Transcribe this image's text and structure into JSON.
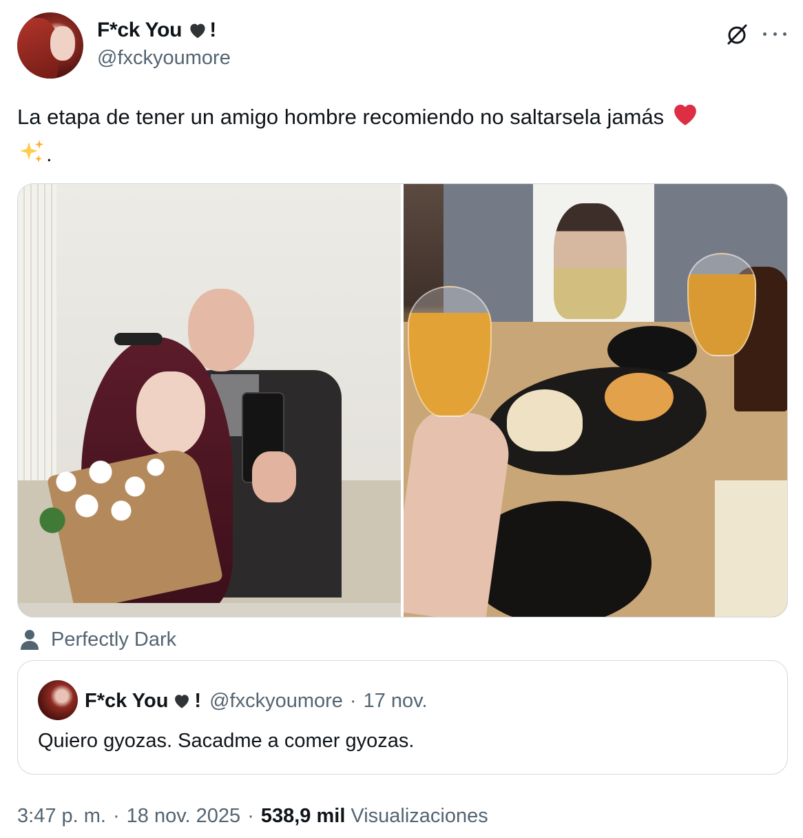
{
  "author": {
    "name": "F*ck You",
    "name_suffix": "!",
    "handle": "@fxckyoumore",
    "heart_color": "#2f3336"
  },
  "header_icons": [
    "grok-icon",
    "more-options-icon"
  ],
  "tweet": {
    "text": "La etapa de tener un amigo hombre recomiendo no saltarsela jamás",
    "text_trailing": ".",
    "emoji_heart_color": "#e0245e"
  },
  "media": {
    "count": 2
  },
  "attribution": {
    "label": "Perfectly Dark"
  },
  "quote": {
    "name": "F*ck You",
    "name_suffix": "!",
    "handle": "@fxckyoumore",
    "separator": "·",
    "date": "17 nov.",
    "text": "Quiero gyozas. Sacadme a comer gyozas."
  },
  "meta": {
    "time": "3:47 p. m.",
    "separator": "·",
    "date": "18 nov. 2025",
    "views_count": "538,9 mil",
    "views_label": "Visualizaciones"
  },
  "colors": {
    "text_primary": "#0f1419",
    "text_secondary": "#536471",
    "border": "#cfd9de"
  }
}
